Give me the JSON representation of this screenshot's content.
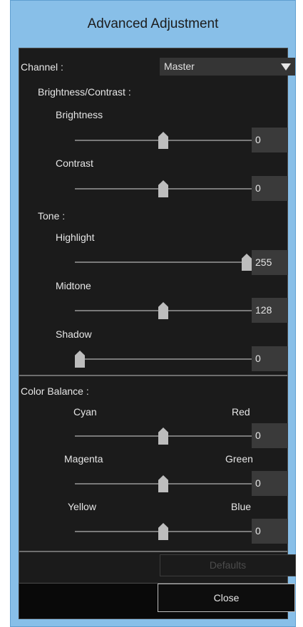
{
  "window": {
    "title": "Advanced Adjustment"
  },
  "channel": {
    "label": "Channel :",
    "value": "Master"
  },
  "brightness_contrast": {
    "heading": "Brightness/Contrast :",
    "brightness": {
      "label": "Brightness",
      "value": "0",
      "level": 0.5
    },
    "contrast": {
      "label": "Contrast",
      "value": "0",
      "level": 0.5
    }
  },
  "tone": {
    "heading": "Tone :",
    "highlight": {
      "label": "Highlight",
      "value": "255",
      "level": 1.0
    },
    "midtone": {
      "label": "Midtone",
      "value": "128",
      "level": 0.5
    },
    "shadow": {
      "label": "Shadow",
      "value": "0",
      "level": 0.0
    }
  },
  "color_balance": {
    "heading": "Color Balance :",
    "cyan_red": {
      "left": "Cyan",
      "right": "Red",
      "value": "0",
      "level": 0.5
    },
    "magenta_green": {
      "left": "Magenta",
      "right": "Green",
      "value": "0",
      "level": 0.5
    },
    "yellow_blue": {
      "left": "Yellow",
      "right": "Blue",
      "value": "0",
      "level": 0.5
    }
  },
  "buttons": {
    "defaults": "Defaults",
    "close": "Close"
  },
  "colors": {
    "window_frame": "#88bfe8",
    "panel_bg": "#1b1b1b",
    "value_box": "#3a3a3a"
  }
}
